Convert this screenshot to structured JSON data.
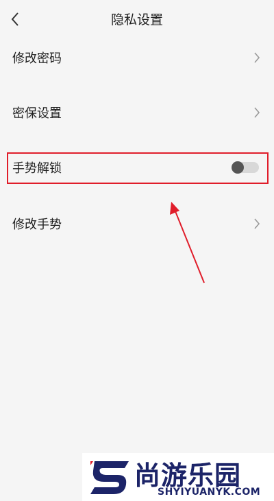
{
  "header": {
    "title": "隐私设置",
    "back_icon": "chevron-left-icon"
  },
  "settings": {
    "items": [
      {
        "label": "修改密码",
        "control": "chevron-right-icon"
      },
      {
        "label": "密保设置",
        "control": "chevron-right-icon"
      },
      {
        "label": "手势解锁",
        "control": "toggle",
        "toggle_on": false
      },
      {
        "label": "修改手势",
        "control": "chevron-right-icon"
      }
    ]
  },
  "annotation": {
    "highlight_color": "#e01d2a",
    "arrow_color": "#e01d2a"
  },
  "watermark": {
    "name": "尚游乐园",
    "domain": "SHYIYUANYK.COM",
    "color": "#1c2468"
  }
}
